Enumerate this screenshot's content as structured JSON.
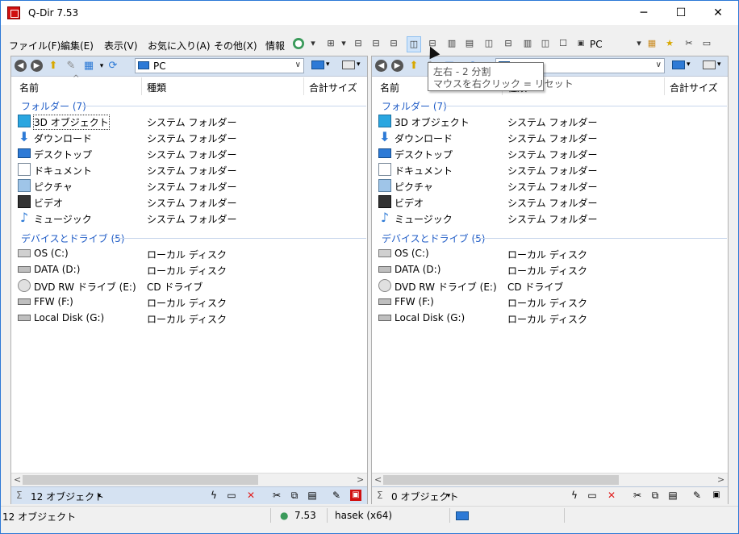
{
  "window": {
    "title": "Q-Dir 7.53",
    "minimize": "─",
    "maximize": "☐",
    "close": "✕"
  },
  "menu": {
    "items": [
      "ファイル(F)",
      "編集(E)",
      "表示(V)",
      "お気に入り(A)",
      "その他(X)",
      "情報"
    ],
    "pc_label": "PC"
  },
  "tooltip": {
    "line1": "左右 - 2 分割",
    "line2": "マウスを右クリック = リセット"
  },
  "left_pane": {
    "address": "PC",
    "columns": [
      "名前",
      "種類",
      "合計サイズ"
    ],
    "groups": [
      {
        "label": "フォルダー (7)"
      },
      {
        "label": "デバイスとドライブ (5)"
      }
    ],
    "folders": [
      {
        "name": "3D オブジェクト",
        "type": "システム フォルダー",
        "icon": "3d-objects-icon"
      },
      {
        "name": "ダウンロード",
        "type": "システム フォルダー",
        "icon": "download-icon"
      },
      {
        "name": "デスクトップ",
        "type": "システム フォルダー",
        "icon": "desktop-icon"
      },
      {
        "name": "ドキュメント",
        "type": "システム フォルダー",
        "icon": "document-icon"
      },
      {
        "name": "ピクチャ",
        "type": "システム フォルダー",
        "icon": "picture-icon"
      },
      {
        "name": "ビデオ",
        "type": "システム フォルダー",
        "icon": "video-icon"
      },
      {
        "name": "ミュージック",
        "type": "システム フォルダー",
        "icon": "music-icon"
      }
    ],
    "drives": [
      {
        "name": "OS (C:)",
        "type": "ローカル ディスク",
        "icon": "os-drive-icon"
      },
      {
        "name": "DATA (D:)",
        "type": "ローカル ディスク",
        "icon": "drive-icon"
      },
      {
        "name": "DVD RW ドライブ (E:)",
        "type": "CD ドライブ",
        "icon": "dvd-icon"
      },
      {
        "name": "FFW (F:)",
        "type": "ローカル ディスク",
        "icon": "drive-icon"
      },
      {
        "name": "Local Disk (G:)",
        "type": "ローカル ディスク",
        "icon": "drive-icon"
      }
    ],
    "status": "12 オブジェクト"
  },
  "right_pane": {
    "address": "",
    "columns": [
      "名前",
      "種類",
      "合計サイズ"
    ],
    "groups": [
      {
        "label": "フォルダー (7)"
      },
      {
        "label": "デバイスとドライブ (5)"
      }
    ],
    "folders": [
      {
        "name": "3D オブジェクト",
        "type": "システム フォルダー",
        "icon": "3d-objects-icon"
      },
      {
        "name": "ダウンロード",
        "type": "システム フォルダー",
        "icon": "download-icon"
      },
      {
        "name": "デスクトップ",
        "type": "システム フォルダー",
        "icon": "desktop-icon"
      },
      {
        "name": "ドキュメント",
        "type": "システム フォルダー",
        "icon": "document-icon"
      },
      {
        "name": "ピクチャ",
        "type": "システム フォルダー",
        "icon": "picture-icon"
      },
      {
        "name": "ビデオ",
        "type": "システム フォルダー",
        "icon": "video-icon"
      },
      {
        "name": "ミュージック",
        "type": "システム フォルダー",
        "icon": "music-icon"
      }
    ],
    "drives": [
      {
        "name": "OS (C:)",
        "type": "ローカル ディスク",
        "icon": "os-drive-icon"
      },
      {
        "name": "DATA (D:)",
        "type": "ローカル ディスク",
        "icon": "drive-icon"
      },
      {
        "name": "DVD RW ドライブ (E:)",
        "type": "CD ドライブ",
        "icon": "dvd-icon"
      },
      {
        "name": "FFW (F:)",
        "type": "ローカル ディスク",
        "icon": "drive-icon"
      },
      {
        "name": "Local Disk (G:)",
        "type": "ローカル ディスク",
        "icon": "drive-icon"
      }
    ],
    "status": "0 オブジェクト"
  },
  "statusbar": {
    "objects": "12 オブジェクト",
    "version": "7.53",
    "user": "hasek (x64)"
  },
  "colors": {
    "accent": "#2b78d6",
    "group_header": "#1e5bc6",
    "pane_bar": "#d5e2f2",
    "delete_red": "#e02020"
  }
}
